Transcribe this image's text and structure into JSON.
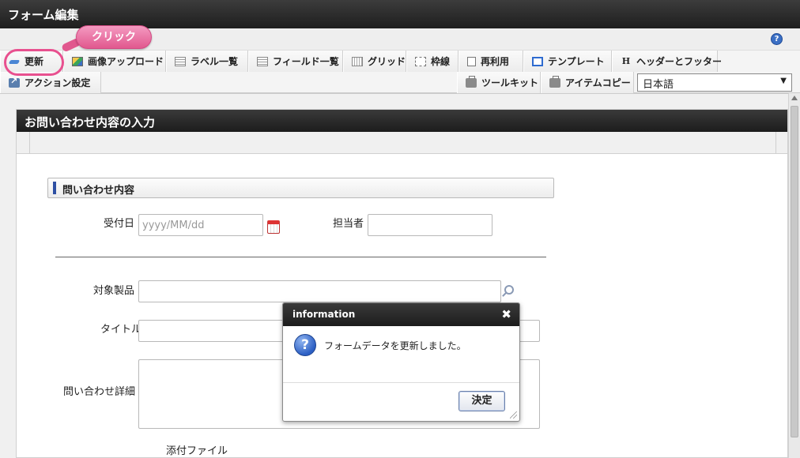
{
  "window": {
    "title": "フォーム編集"
  },
  "help": {
    "glyph": "?"
  },
  "callout": {
    "label": "クリック",
    "color": "#e8508f"
  },
  "toolbar": {
    "row1": [
      {
        "id": "update",
        "label": "更新",
        "icon": "update-icon"
      },
      {
        "id": "image-upload",
        "label": "画像アップロード",
        "icon": "image-icon"
      },
      {
        "id": "label-list",
        "label": "ラベル一覧",
        "icon": "list-icon"
      },
      {
        "id": "field-list",
        "label": "フィールド一覧",
        "icon": "list-icon"
      },
      {
        "id": "grid",
        "label": "グリッド",
        "icon": "grid-icon"
      },
      {
        "id": "border",
        "label": "枠線",
        "icon": "frame-icon"
      },
      {
        "id": "reuse",
        "label": "再利用",
        "icon": "document-icon"
      },
      {
        "id": "template",
        "label": "テンプレート",
        "icon": "template-icon"
      },
      {
        "id": "header-footer",
        "label": "ヘッダーとフッター",
        "icon": "header-icon",
        "glyph": "H"
      }
    ],
    "row2": {
      "action": {
        "label": "アクション設定",
        "icon": "action-icon"
      },
      "toolkit": {
        "label": "ツールキット",
        "icon": "briefcase-icon"
      },
      "item_copy": {
        "label": "アイテムコピー",
        "icon": "briefcase-icon"
      },
      "language": {
        "selected": "日本語",
        "arrow": "▼"
      }
    }
  },
  "form": {
    "title": "お問い合わせ内容の入力",
    "section": "問い合わせ内容",
    "fields": {
      "receipt_date": {
        "label": "受付日",
        "placeholder": "yyyy/MM/dd"
      },
      "assignee": {
        "label": "担当者",
        "value": ""
      },
      "product": {
        "label": "対象製品",
        "value": ""
      },
      "title": {
        "label": "タイトル",
        "value": ""
      },
      "detail": {
        "label": "問い合わせ詳細",
        "value": ""
      },
      "attachment": {
        "label": "添付ファイル"
      }
    }
  },
  "dialog": {
    "title": "information",
    "close": "✖",
    "icon_glyph": "?",
    "message": "フォームデータを更新しました。",
    "ok_label": "決定"
  }
}
